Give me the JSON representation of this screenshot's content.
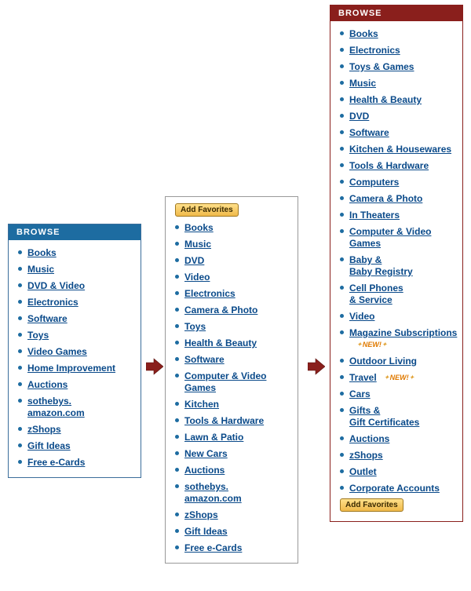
{
  "labels": {
    "browse": "BROWSE",
    "add_favorites": "Add Favorites",
    "new": "NEW!"
  },
  "panel1": {
    "items": [
      {
        "label": "Books"
      },
      {
        "label": "Music"
      },
      {
        "label": "DVD & Video"
      },
      {
        "label": "Electronics"
      },
      {
        "label": "Software"
      },
      {
        "label": "Toys"
      },
      {
        "label": "Video Games"
      },
      {
        "label": "Home Improvement"
      },
      {
        "label": "Auctions"
      },
      {
        "label": "sothebys.\namazon.com"
      },
      {
        "label": "zShops"
      },
      {
        "label": "Gift Ideas"
      },
      {
        "label": "Free e-Cards"
      }
    ]
  },
  "panel2": {
    "items": [
      {
        "label": "Books"
      },
      {
        "label": "Music"
      },
      {
        "label": "DVD"
      },
      {
        "label": "Video"
      },
      {
        "label": "Electronics"
      },
      {
        "label": "Camera & Photo"
      },
      {
        "label": "Toys"
      },
      {
        "label": "Health & Beauty"
      },
      {
        "label": "Software"
      },
      {
        "label": "Computer & Video Games"
      },
      {
        "label": "Kitchen"
      },
      {
        "label": "Tools & Hardware"
      },
      {
        "label": "Lawn & Patio"
      },
      {
        "label": "New Cars"
      },
      {
        "label": "Auctions"
      },
      {
        "label": "sothebys.\namazon.com"
      },
      {
        "label": "zShops"
      },
      {
        "label": "Gift Ideas"
      },
      {
        "label": "Free e-Cards"
      }
    ]
  },
  "panel3": {
    "items": [
      {
        "label": "Books"
      },
      {
        "label": "Electronics"
      },
      {
        "label": "Toys & Games"
      },
      {
        "label": "Music"
      },
      {
        "label": "Health & Beauty"
      },
      {
        "label": "DVD"
      },
      {
        "label": "Software"
      },
      {
        "label": "Kitchen & Housewares"
      },
      {
        "label": "Tools & Hardware"
      },
      {
        "label": "Computers"
      },
      {
        "label": "Camera & Photo"
      },
      {
        "label": "In Theaters"
      },
      {
        "label": "Computer & Video Games"
      },
      {
        "label": "Baby &\nBaby Registry"
      },
      {
        "label": "Cell Phones\n& Service"
      },
      {
        "label": "Video"
      },
      {
        "label": "Magazine Subscriptions",
        "new": true
      },
      {
        "label": "Outdoor Living"
      },
      {
        "label": "Travel",
        "new": true
      },
      {
        "label": "Cars"
      },
      {
        "label": "Gifts &\nGift Certificates"
      },
      {
        "label": "Auctions"
      },
      {
        "label": "zShops"
      },
      {
        "label": "Outlet"
      },
      {
        "label": "Corporate Accounts"
      }
    ]
  }
}
